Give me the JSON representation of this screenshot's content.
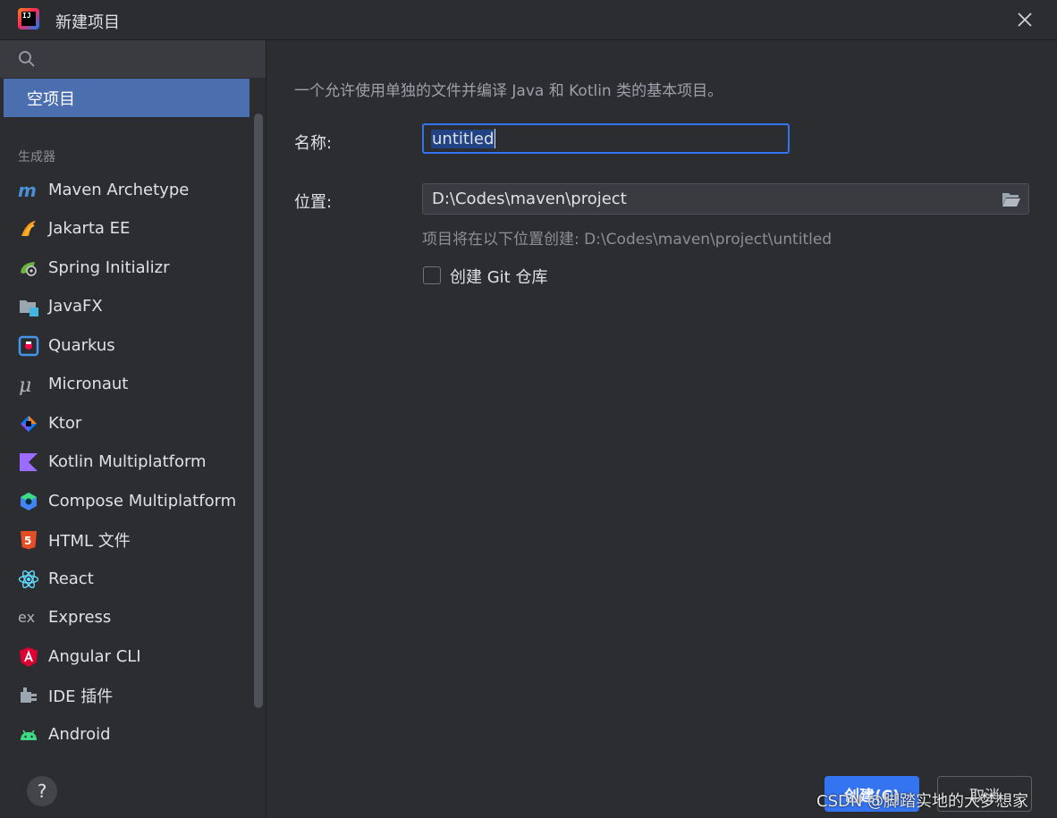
{
  "window": {
    "title": "新建项目"
  },
  "sidebar": {
    "search_placeholder": "",
    "selected_item": "空项目",
    "group_label": "生成器",
    "generators": [
      {
        "label": "Maven Archetype",
        "icon": "maven-icon"
      },
      {
        "label": "Jakarta EE",
        "icon": "jakarta-ee-icon"
      },
      {
        "label": "Spring Initializr",
        "icon": "spring-icon"
      },
      {
        "label": "JavaFX",
        "icon": "javafx-icon"
      },
      {
        "label": "Quarkus",
        "icon": "quarkus-icon"
      },
      {
        "label": "Micronaut",
        "icon": "micronaut-icon"
      },
      {
        "label": "Ktor",
        "icon": "ktor-icon"
      },
      {
        "label": "Kotlin Multiplatform",
        "icon": "kotlin-icon"
      },
      {
        "label": "Compose Multiplatform",
        "icon": "compose-icon"
      },
      {
        "label": "HTML 文件",
        "icon": "html5-icon"
      },
      {
        "label": "React",
        "icon": "react-icon"
      },
      {
        "label": "Express",
        "icon": "express-icon"
      },
      {
        "label": "Angular CLI",
        "icon": "angular-icon"
      },
      {
        "label": "IDE 插件",
        "icon": "plugin-icon"
      },
      {
        "label": "Android",
        "icon": "android-icon"
      }
    ],
    "help_label": "?"
  },
  "main": {
    "description": "一个允许使用单独的文件并编译 Java 和 Kotlin 类的基本项目。",
    "name_label": "名称:",
    "name_value": "untitled",
    "location_label": "位置:",
    "location_value": "D:\\Codes\\maven\\project",
    "path_hint": "项目将在以下位置创建: D:\\Codes\\maven\\project\\untitled",
    "git_label": "创建 Git 仓库",
    "git_checked": false
  },
  "footer": {
    "create_label": "创建(C)",
    "cancel_label": "取消"
  },
  "watermark": "CSDN @脚踏实地的大梦想家",
  "colors": {
    "background": "#2b2d30",
    "selection": "#4b6eaf",
    "accent": "#3574f0",
    "input_background": "#393b40"
  }
}
